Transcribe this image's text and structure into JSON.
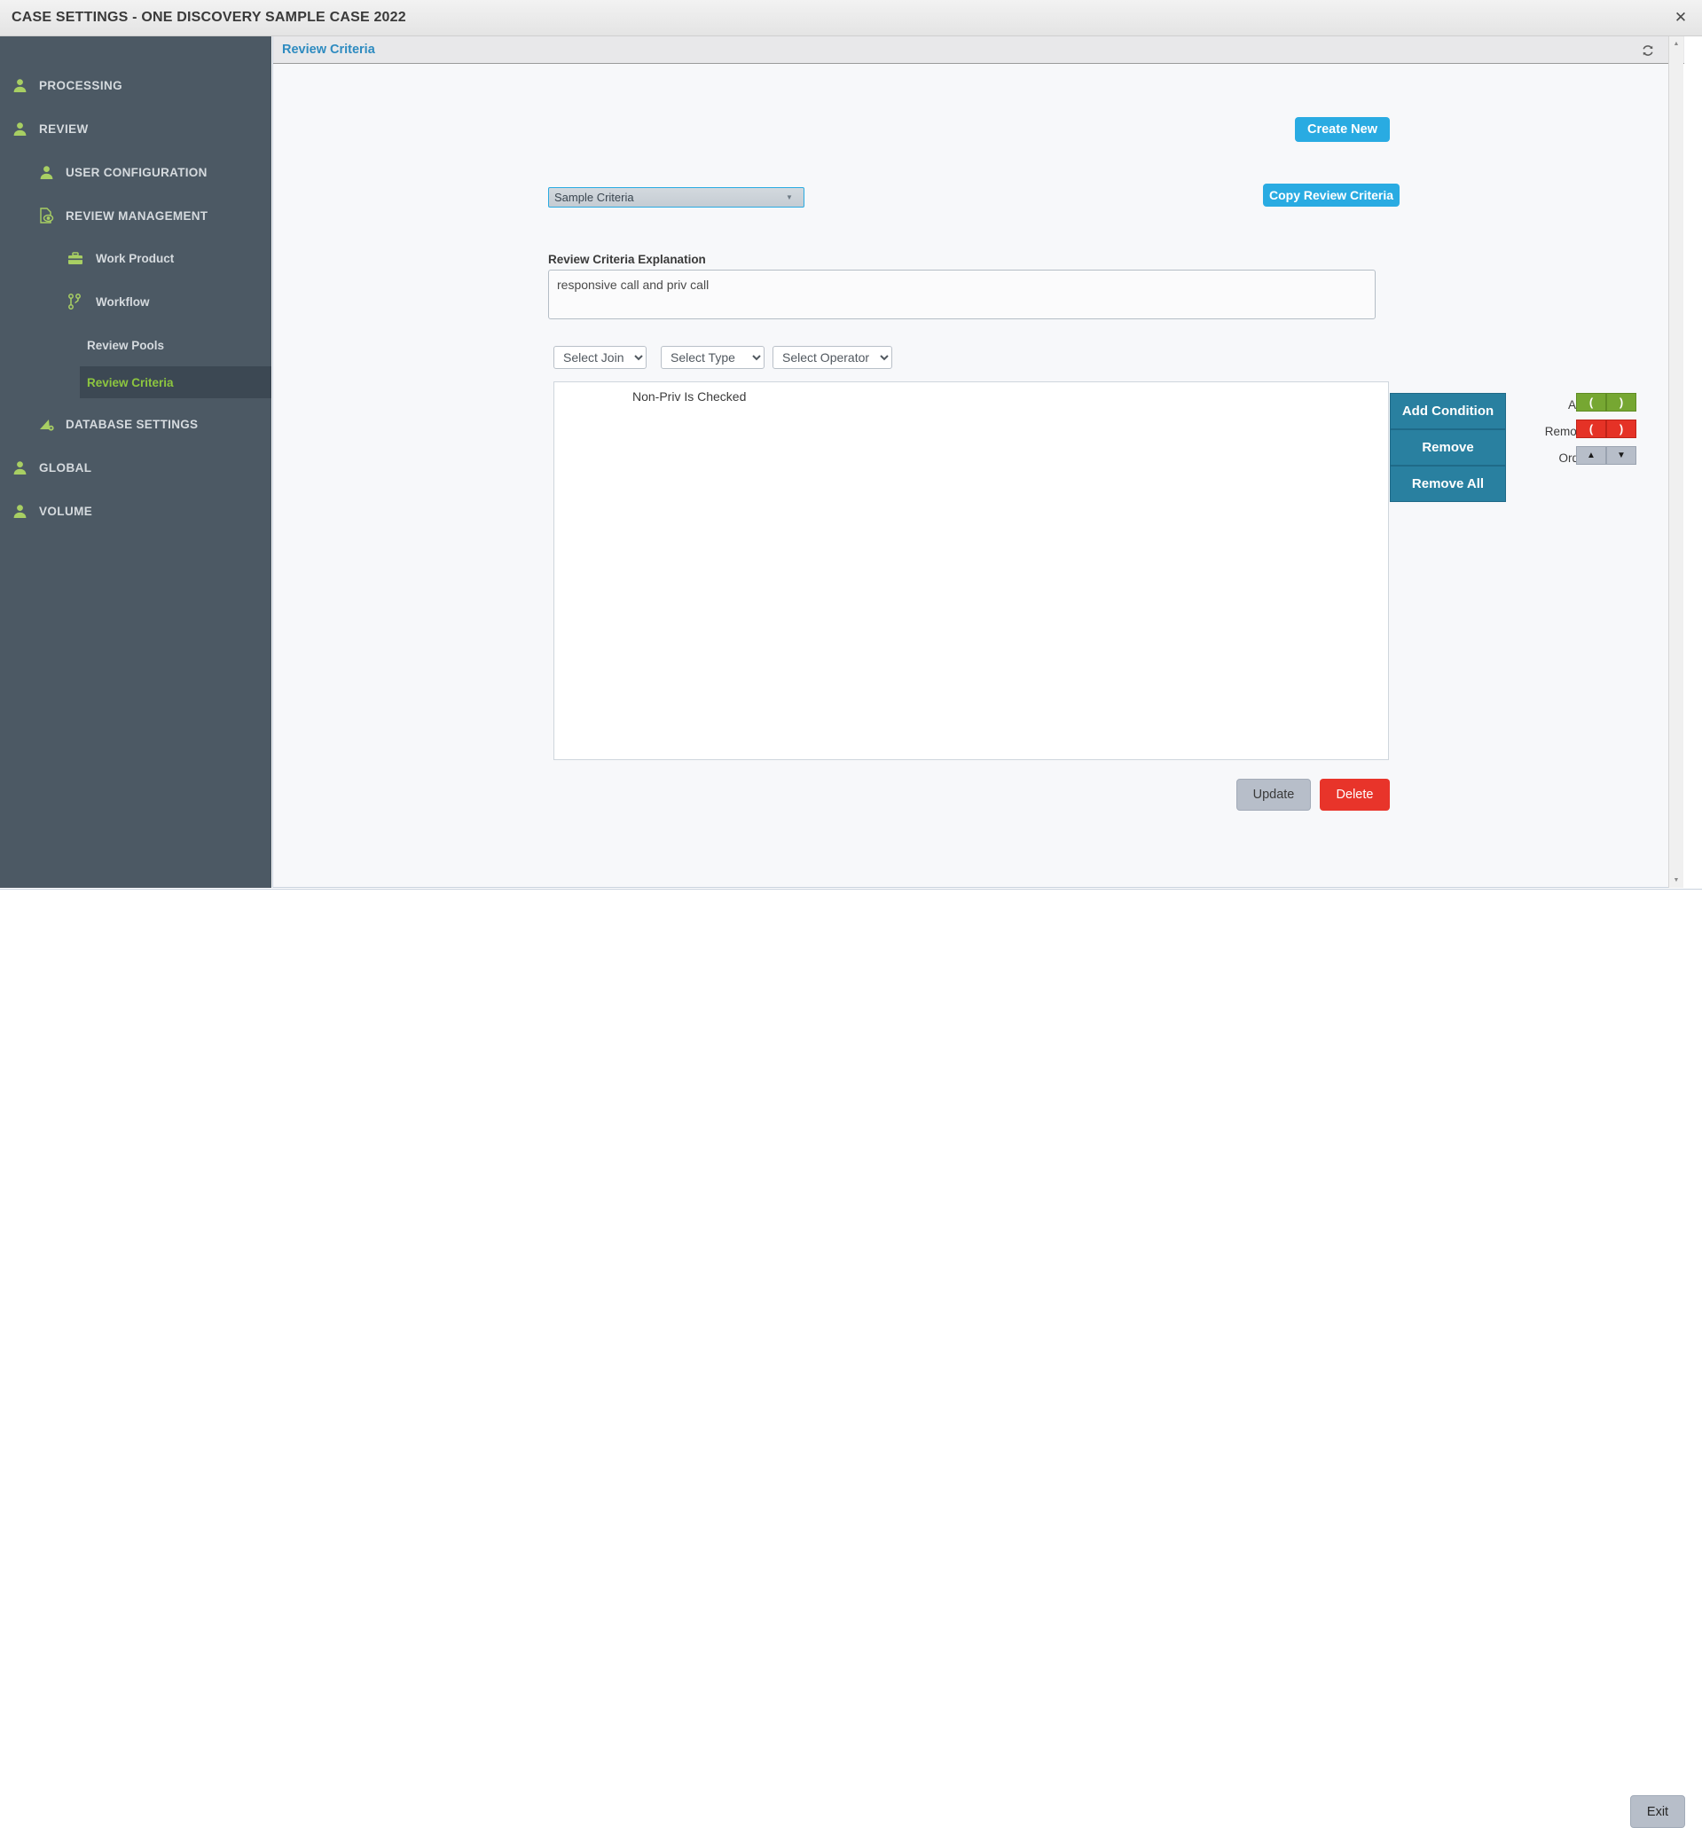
{
  "window": {
    "title": "CASE SETTINGS - ONE DISCOVERY SAMPLE CASE 2022",
    "close_label": "✕"
  },
  "sidebar": {
    "background_color": "#4c5964",
    "accent_color": "#8dc63f",
    "items": [
      {
        "label": "PROCESSING",
        "icon": "person-icon",
        "level": 0,
        "selected": false
      },
      {
        "label": "REVIEW",
        "icon": "person-icon",
        "level": 0,
        "selected": false
      },
      {
        "label": "USER CONFIGURATION",
        "icon": "person-icon",
        "level": 1,
        "selected": false
      },
      {
        "label": "REVIEW MANAGEMENT",
        "icon": "document-eye-icon",
        "level": 1,
        "selected": false
      },
      {
        "label": "Work Product",
        "icon": "briefcase-icon",
        "level": 2,
        "selected": false
      },
      {
        "label": "Workflow",
        "icon": "workflow-icon",
        "level": 2,
        "selected": false
      },
      {
        "label": "Review Pools",
        "icon": "none",
        "level": 3,
        "selected": false
      },
      {
        "label": "Review Criteria",
        "icon": "none",
        "level": 3,
        "selected": true
      },
      {
        "label": "DATABASE SETTINGS",
        "icon": "database-gear-icon",
        "level": 1,
        "selected": false
      },
      {
        "label": "GLOBAL",
        "icon": "person-icon",
        "level": 0,
        "selected": false
      },
      {
        "label": "VOLUME",
        "icon": "person-icon",
        "level": 0,
        "selected": false
      }
    ]
  },
  "panel": {
    "title": "Review Criteria",
    "title_color": "#2e8bc0",
    "refresh_icon": "refresh-icon"
  },
  "main": {
    "create_new_label": "Create New",
    "copy_review_criteria_label": "Copy Review Criteria",
    "primary_button_color": "#29abe2",
    "criteria_select": {
      "value": "Sample Criteria",
      "options": [
        "Sample Criteria"
      ]
    },
    "explanation": {
      "label": "Review Criteria Explanation",
      "value": "responsive call and priv call",
      "placeholder": ""
    },
    "filters": [
      {
        "name": "select-join",
        "value": "Select Join",
        "options": [
          "Select Join"
        ]
      },
      {
        "name": "select-type",
        "value": "Select Type",
        "options": [
          "Select Type"
        ]
      },
      {
        "name": "select-operator",
        "value": "Select Operator",
        "options": [
          "Select Operator"
        ]
      }
    ],
    "conditions": [
      "Non-Priv Is Checked"
    ],
    "condition_buttons": {
      "add_condition_label": "Add Condition",
      "remove_label": "Remove",
      "remove_all_label": "Remove All",
      "color": "#2980a0"
    },
    "paren_controls": {
      "add_label": "Add",
      "remove_label": "Remove",
      "order_label": "Order",
      "open_paren": "(",
      "close_paren": ")",
      "order_up": "▲",
      "order_down": "▼",
      "add_color": "#76a732",
      "remove_color": "#e53226",
      "order_color": "#b7bec9"
    },
    "update_label": "Update",
    "delete_label": "Delete",
    "delete_color": "#e8342a"
  },
  "footer": {
    "exit_label": "Exit"
  },
  "scrollbar": {
    "up_arrow": "▲",
    "down_arrow": "▼"
  }
}
